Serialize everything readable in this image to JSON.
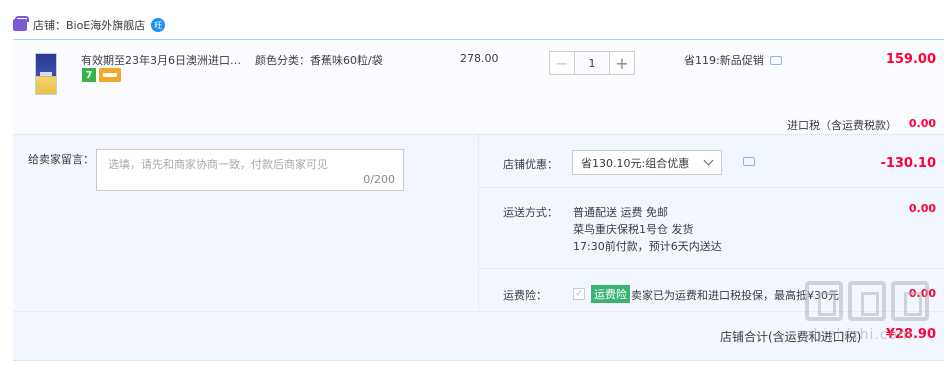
{
  "shop": {
    "label": "店铺：BioE海外旗舰店",
    "wang_badge": "旺"
  },
  "item": {
    "title": "有效期至23年3月6日澳洲进口…",
    "badge_seven": "7",
    "sku": "颜色分类：香蕉味60粒/袋",
    "unit_price": "278.00",
    "quantity": "1",
    "minus_label": "−",
    "plus_label": "+",
    "promo": "省119:新品促销",
    "subtotal": "159.00",
    "tax_label": "进口税（含运费税款）",
    "tax_value": "0.00"
  },
  "order": {
    "message_label": "给卖家留言：",
    "message_placeholder": "选填，请先和商家协商一致，付款后商家可见",
    "message_count": "0/200",
    "coupon_label": "店铺优惠：",
    "coupon_selected": "省130.10元:组合优惠",
    "coupon_value": "-130.10",
    "shipping_label": "运送方式：",
    "shipping_line1": "普通配送 运费 免邮",
    "shipping_line2": "菜鸟重庆保税1号仓   发货",
    "shipping_line3": "17:30前付款，预计6天内送达",
    "shipping_value": "0.00",
    "insurance_label": "运费险：",
    "insurance_tag": "运费险",
    "insurance_text": "卖家已为运费和进口税投保，最高抵¥30元",
    "insurance_value": "0.00",
    "total_label": "店铺合计(含运费和进口税)",
    "total_value": "¥28.90"
  },
  "watermark": {
    "text": "zhizhizhi.com"
  },
  "colors": {
    "accent_red": "#ff0036",
    "border_blue": "#b2d1ff",
    "panel_bg": "#f2f7ff",
    "insurance_green": "#3cb371"
  }
}
